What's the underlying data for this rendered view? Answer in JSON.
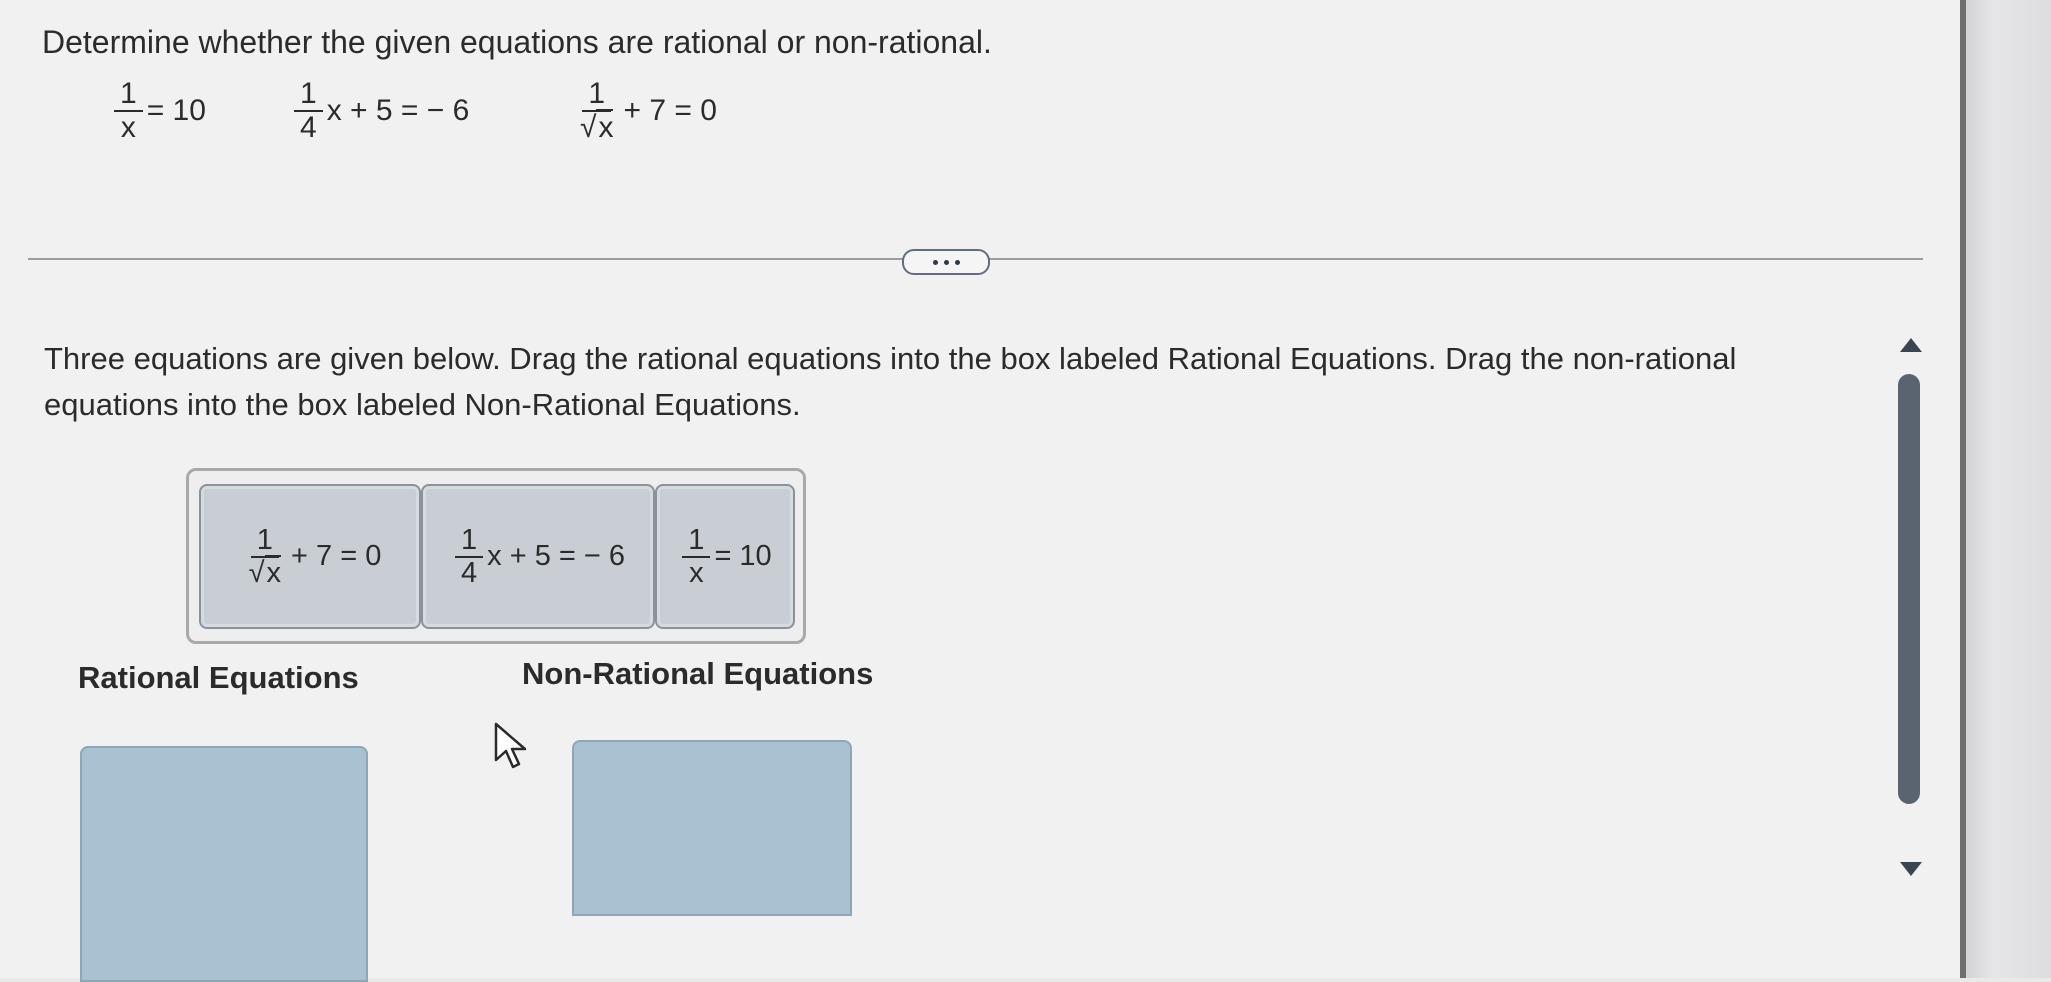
{
  "question": "Determine whether the given equations are rational or non-rational.",
  "equations_top": [
    {
      "num": "1",
      "den": "x",
      "rest": "= 10"
    },
    {
      "num": "1",
      "den": "4",
      "rest": "x + 5 = − 6"
    },
    {
      "num": "1",
      "den": "x",
      "sqrt": true,
      "rest": "+ 7 = 0"
    }
  ],
  "instructions": "Three equations are given below. Drag the rational equations into the box labeled Rational Equations. Drag the non-rational equations into the box labeled Non-Rational Equations.",
  "tiles": [
    {
      "num": "1",
      "den": "x",
      "sqrt": true,
      "rest": "+ 7 = 0"
    },
    {
      "num": "1",
      "den": "4",
      "rest": "x + 5 = − 6"
    },
    {
      "num": "1",
      "den": "x",
      "rest": "= 10"
    }
  ],
  "targets": {
    "rational_label": "Rational Equations",
    "nonrational_label": "Non-Rational Equations"
  },
  "colors": {
    "tile_fill": "#c8ced4",
    "target_fill": "#a9c2d1",
    "scrollbar": "#5a6470"
  }
}
